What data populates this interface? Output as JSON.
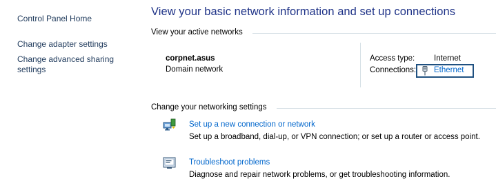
{
  "sidebar": {
    "items": [
      {
        "label": "Control Panel Home"
      },
      {
        "label": "Change adapter settings"
      },
      {
        "label": "Change advanced sharing"
      },
      {
        "label": "settings"
      }
    ]
  },
  "main": {
    "title": "View your basic network information and set up connections",
    "active_networks": {
      "heading": "View your active networks",
      "network_name": "corpnet.asus",
      "network_type": "Domain network",
      "access_type_label": "Access type:",
      "access_type_value": "Internet",
      "connections_label": "Connections:",
      "connections_value": "Ethernet",
      "connection_icon": "ethernet-plug-icon"
    },
    "networking_settings": {
      "heading": "Change your networking settings",
      "tasks": [
        {
          "icon": "network-setup-icon",
          "link": "Set up a new connection or network",
          "description": "Set up a broadband, dial-up, or VPN connection; or set up a router or access point."
        },
        {
          "icon": "troubleshoot-icon",
          "link": "Troubleshoot problems",
          "description": "Diagnose and repair network problems, or get troubleshooting information."
        }
      ]
    }
  },
  "colors": {
    "link": "#0066cc",
    "title": "#1e3287",
    "sidebar_link": "#1e395b",
    "divider": "#d5dfe5",
    "focus_border": "#1f5080"
  }
}
